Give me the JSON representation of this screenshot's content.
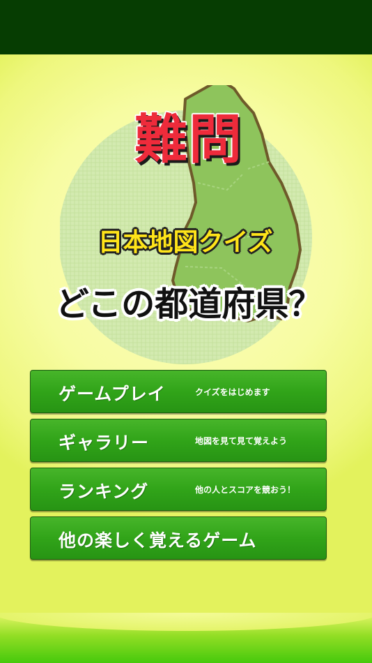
{
  "logo": {
    "title": "難問",
    "subtitle": "日本地図クイズ",
    "question": "どこの都道府県？",
    "colors": {
      "circle": "#d6ecb0",
      "map_fill": "#8ec45c",
      "map_stroke": "#6e5a2a",
      "title": "#ee2b3b",
      "subtitle": "#ffe419"
    }
  },
  "menu": {
    "items": [
      {
        "label": "ゲームプレイ",
        "desc": "クイズをはじめます"
      },
      {
        "label": "ギャラリー",
        "desc": "地図を見て見て覚えよう"
      },
      {
        "label": "ランキング",
        "desc": "他の人とスコアを競おう！"
      },
      {
        "label": "他の楽しく覚えるゲーム",
        "desc": ""
      }
    ],
    "button_color": "#31a419"
  }
}
